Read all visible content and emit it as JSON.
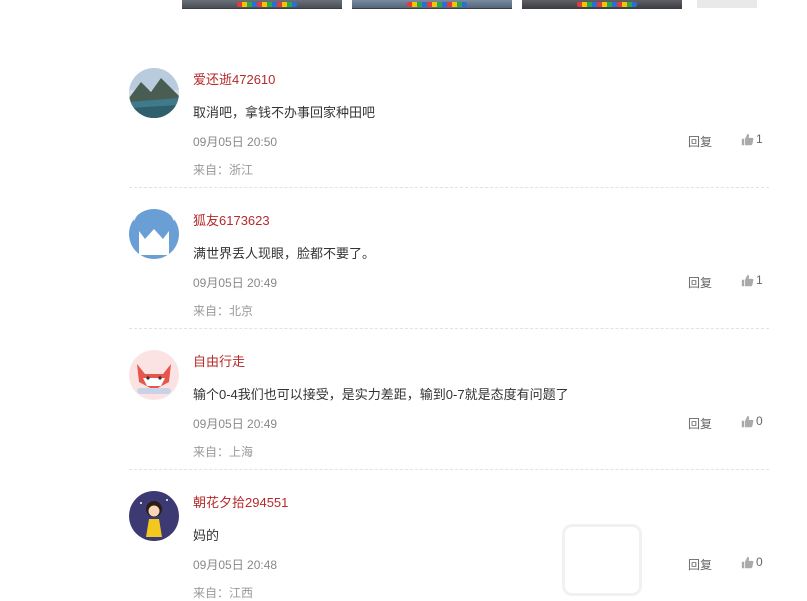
{
  "comments": [
    {
      "username": "爱还逝472610",
      "content": "取消吧，拿钱不办事回家种田吧",
      "time": "09月05日 20:50",
      "reply_label": "回复",
      "likes": "1",
      "location": "来自：浙江"
    },
    {
      "username": "狐友6173623",
      "content": "满世界丢人现眼，脸都不要了。",
      "time": "09月05日 20:49",
      "reply_label": "回复",
      "likes": "1",
      "location": "来自：北京"
    },
    {
      "username": "自由行走",
      "content": "输个0-4我们也可以接受，是实力差距，输到0-7就是态度有问题了",
      "time": "09月05日 20:49",
      "reply_label": "回复",
      "likes": "0",
      "location": "来自：上海"
    },
    {
      "username": "朝花夕拾294551",
      "content": "妈的",
      "time": "09月05日 20:48",
      "reply_label": "回复",
      "likes": "0",
      "location": "来自：江西"
    }
  ],
  "icons": {
    "like": "thumbs-up-icon"
  },
  "colors": {
    "username": "#b52a2a",
    "text": "#333333",
    "meta": "#888888"
  }
}
